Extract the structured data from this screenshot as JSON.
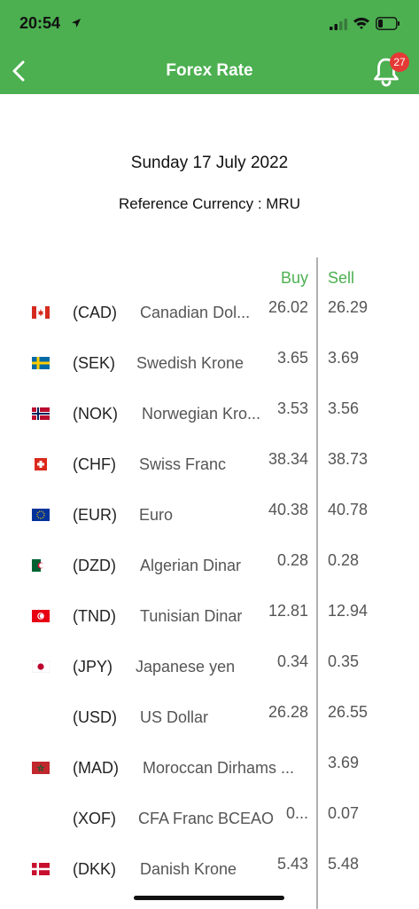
{
  "status_bar": {
    "time": "20:54"
  },
  "header": {
    "title": "Forex Rate",
    "notification_count": "27",
    "accent": "#4caf50"
  },
  "date": "Sunday 17 July 2022",
  "reference": "Reference Currency : MRU",
  "columns": {
    "buy": "Buy",
    "sell": "Sell"
  },
  "rates": [
    {
      "code": "(CAD)",
      "name": "Canadian Dol...",
      "buy": "26.02",
      "sell": "26.29",
      "flag": "canada-flag-icon"
    },
    {
      "code": "(SEK)",
      "name": "Swedish Krone",
      "buy": "3.65",
      "sell": "3.69",
      "flag": "sweden-flag-icon"
    },
    {
      "code": "(NOK)",
      "name": "Norwegian Kro...",
      "buy": "3.53",
      "sell": "3.56",
      "flag": "norway-flag-icon"
    },
    {
      "code": "(CHF)",
      "name": "Swiss Franc",
      "buy": "38.34",
      "sell": "38.73",
      "flag": "switzerland-flag-icon"
    },
    {
      "code": "(EUR)",
      "name": "Euro",
      "buy": "40.38",
      "sell": "40.78",
      "flag": "eu-flag-icon"
    },
    {
      "code": "(DZD)",
      "name": "Algerian Dinar",
      "buy": "0.28",
      "sell": "0.28",
      "flag": "algeria-flag-icon"
    },
    {
      "code": "(TND)",
      "name": "Tunisian Dinar",
      "buy": "12.81",
      "sell": "12.94",
      "flag": "tunisia-flag-icon"
    },
    {
      "code": "(JPY)",
      "name": "Japanese yen",
      "buy": "0.34",
      "sell": "0.35",
      "flag": "japan-flag-icon"
    },
    {
      "code": "(USD)",
      "name": "US Dollar",
      "buy": "26.28",
      "sell": "26.55",
      "flag": ""
    },
    {
      "code": "(MAD)",
      "name": "Moroccan Dirhams ...",
      "buy": "",
      "sell": "3.69",
      "flag": "morocco-flag-icon"
    },
    {
      "code": "(XOF)",
      "name": "CFA Franc BCEAO",
      "buy": "0...",
      "sell": "0.07",
      "flag": ""
    },
    {
      "code": "(DKK)",
      "name": "Danish Krone",
      "buy": "5.43",
      "sell": "5.48",
      "flag": "denmark-flag-icon"
    }
  ]
}
